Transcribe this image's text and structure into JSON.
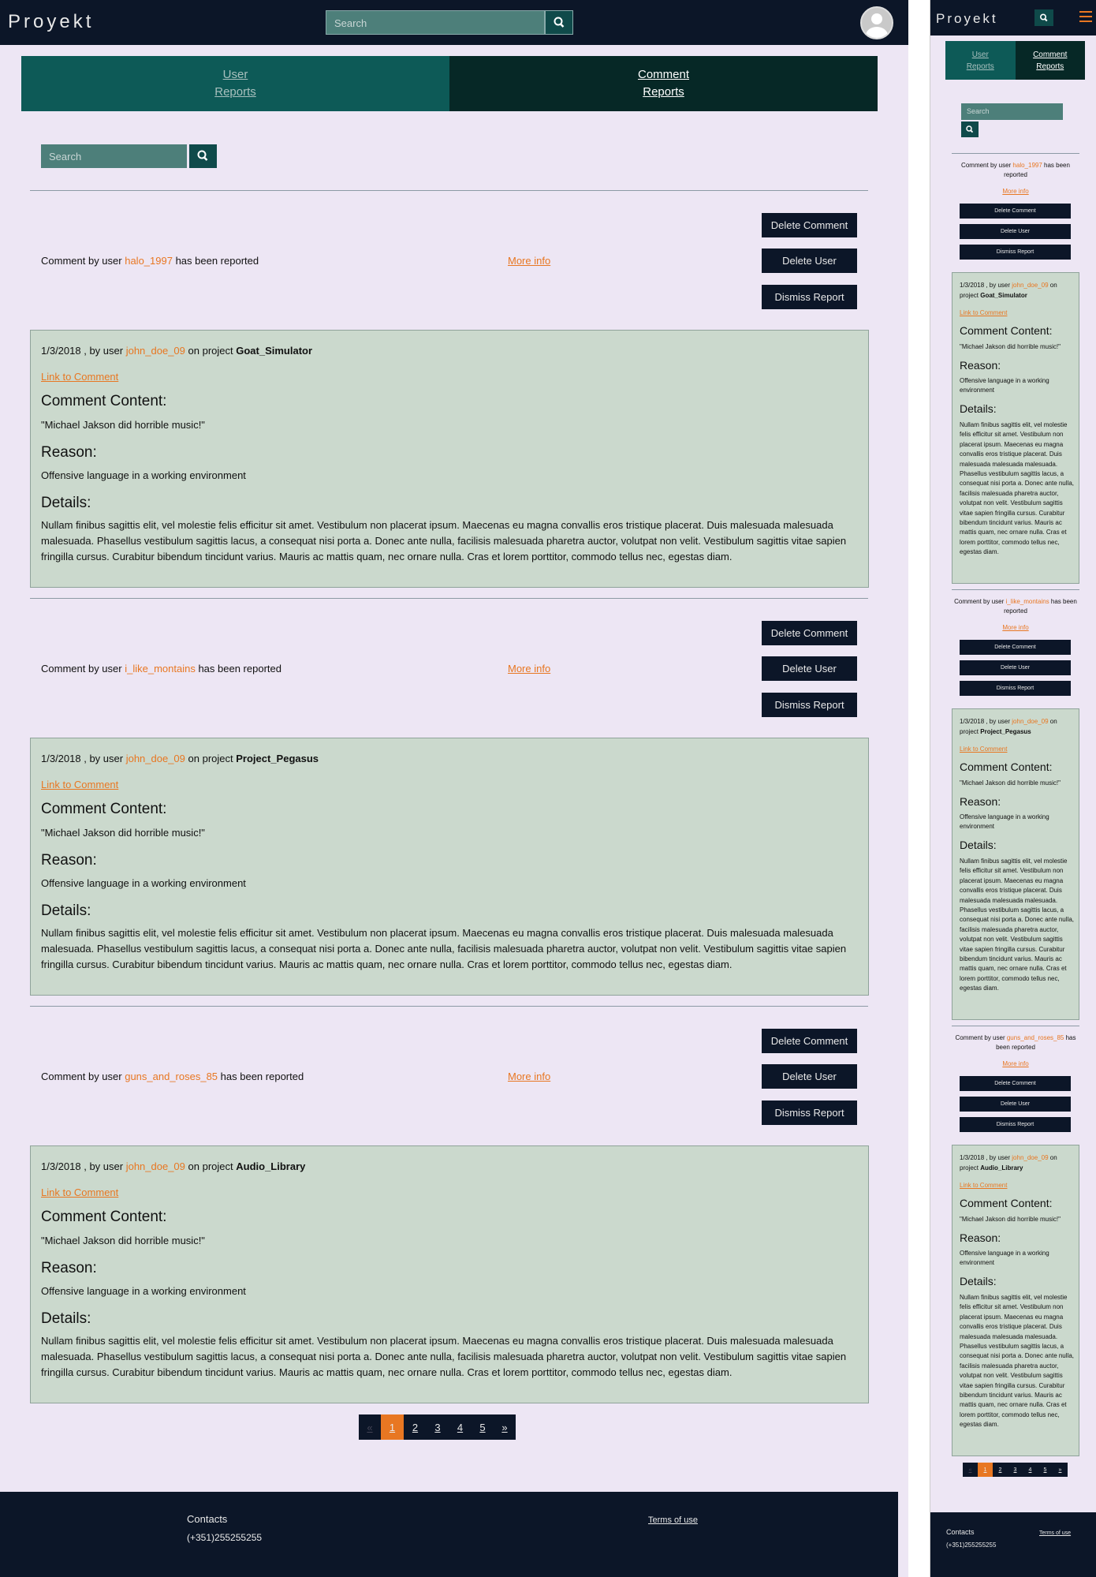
{
  "brand": "Proyekt",
  "nav": {
    "search_placeholder": "Search"
  },
  "tabs": {
    "user_reports": "User Reports",
    "comment_reports": "Comment Reports"
  },
  "content_search_placeholder": "Search",
  "reports": [
    {
      "prefix": "Comment by user",
      "user": "halo_1997",
      "suffix": "has been reported",
      "more_info": "More info",
      "buttons": {
        "delete_comment": "Delete Comment",
        "delete_user": "Delete User",
        "dismiss": "Dismiss Report"
      },
      "date_prefix": "1/3/2018 , by user",
      "author": "john_doe_09",
      "project_prefix": "on project",
      "project": "Goat_Simulator",
      "link_to_comment": "Link to Comment",
      "content_heading": "Comment Content:",
      "content": "\"Michael Jakson did horrible music!\"",
      "reason_heading": "Reason:",
      "reason": "Offensive language in a working environment",
      "details_heading": "Details:",
      "details": "Nullam finibus sagittis elit, vel molestie felis efficitur sit amet. Vestibulum non placerat ipsum. Maecenas eu magna convallis eros tristique placerat. Duis malesuada malesuada malesuada. Phasellus vestibulum sagittis lacus, a consequat nisi porta a. Donec ante nulla, facilisis malesuada pharetra auctor, volutpat non velit. Vestibulum sagittis vitae sapien fringilla cursus. Curabitur bibendum tincidunt varius. Mauris ac mattis quam, nec ornare nulla. Cras et lorem porttitor, commodo tellus nec, egestas diam."
    },
    {
      "prefix": "Comment by user",
      "user": "i_like_montains",
      "suffix": "has been reported",
      "more_info": "More info",
      "buttons": {
        "delete_comment": "Delete Comment",
        "delete_user": "Delete User",
        "dismiss": "Dismiss Report"
      },
      "date_prefix": "1/3/2018 , by user",
      "author": "john_doe_09",
      "project_prefix": "on project",
      "project": "Project_Pegasus",
      "link_to_comment": "Link to Comment",
      "content_heading": "Comment Content:",
      "content": "\"Michael Jakson did horrible music!\"",
      "reason_heading": "Reason:",
      "reason": "Offensive language in a working environment",
      "details_heading": "Details:",
      "details": "Nullam finibus sagittis elit, vel molestie felis efficitur sit amet. Vestibulum non placerat ipsum. Maecenas eu magna convallis eros tristique placerat. Duis malesuada malesuada malesuada. Phasellus vestibulum sagittis lacus, a consequat nisi porta a. Donec ante nulla, facilisis malesuada pharetra auctor, volutpat non velit. Vestibulum sagittis vitae sapien fringilla cursus. Curabitur bibendum tincidunt varius. Mauris ac mattis quam, nec ornare nulla. Cras et lorem porttitor, commodo tellus nec, egestas diam."
    },
    {
      "prefix": "Comment by user",
      "user": "guns_and_roses_85",
      "suffix": "has been reported",
      "more_info": "More info",
      "buttons": {
        "delete_comment": "Delete Comment",
        "delete_user": "Delete User",
        "dismiss": "Dismiss Report"
      },
      "date_prefix": "1/3/2018 , by user",
      "author": "john_doe_09",
      "project_prefix": "on project",
      "project": "Audio_Library",
      "link_to_comment": "Link to Comment",
      "content_heading": "Comment Content:",
      "content": "\"Michael Jakson did horrible music!\"",
      "reason_heading": "Reason:",
      "reason": "Offensive language in a working environment",
      "details_heading": "Details:",
      "details": "Nullam finibus sagittis elit, vel molestie felis efficitur sit amet. Vestibulum non placerat ipsum. Maecenas eu magna convallis eros tristique placerat. Duis malesuada malesuada malesuada. Phasellus vestibulum sagittis lacus, a consequat nisi porta a. Donec ante nulla, facilisis malesuada pharetra auctor, volutpat non velit. Vestibulum sagittis vitae sapien fringilla cursus. Curabitur bibendum tincidunt varius. Mauris ac mattis quam, nec ornare nulla. Cras et lorem porttitor, commodo tellus nec, egestas diam."
    }
  ],
  "pagination": {
    "prev": "«",
    "pages": [
      "1",
      "2",
      "3",
      "4",
      "5"
    ],
    "next": "»",
    "current": "1"
  },
  "footer": {
    "contacts_label": "Contacts",
    "phone": "(+351)255255255",
    "terms": "Terms of use"
  },
  "colors": {
    "navy": "#0c1628",
    "teal": "#0d5a57",
    "dark_teal": "#062826",
    "accent": "#e87722",
    "card": "#cbd9cd",
    "background": "#ede6f4"
  },
  "icons": {
    "search": "search-icon",
    "avatar": "user-avatar-icon",
    "menu": "hamburger-menu-icon"
  }
}
